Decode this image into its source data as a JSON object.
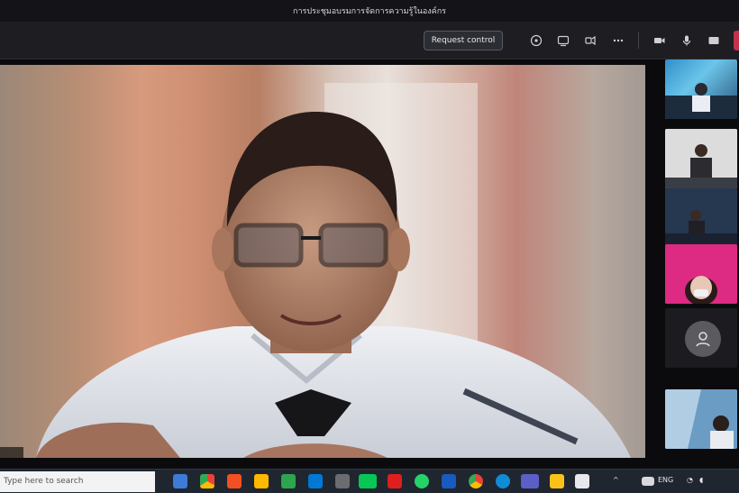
{
  "window": {
    "title": "การประชุมอบรมการจัดการความรู้ในองค์กร"
  },
  "toolbar": {
    "request_control_label": "Request control",
    "icons": [
      "chat-icon",
      "share-icon",
      "reactions-icon",
      "more-icon",
      "camera-icon",
      "mic-icon",
      "share-screen-icon"
    ]
  },
  "main": {
    "participant_label": ""
  },
  "sidebar": {
    "avatar_name": ""
  },
  "taskbar": {
    "search_placeholder": "Type here to search",
    "tray_time": "",
    "colors": {
      "bg": "#1f2630",
      "accent": "#c4314b"
    }
  }
}
